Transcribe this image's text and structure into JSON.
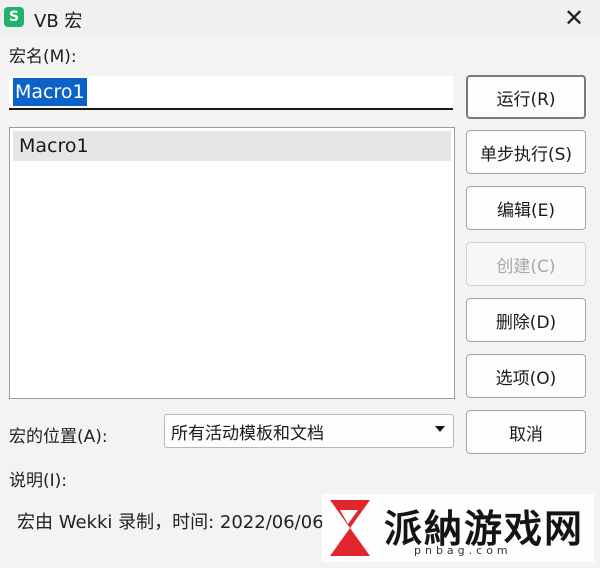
{
  "window": {
    "app_icon_letter": "S",
    "title": "VB 宏",
    "close_symbol": "✕"
  },
  "macro_name": {
    "label": "宏名(M):",
    "value": "Macro1"
  },
  "macro_list": {
    "items": [
      "Macro1"
    ]
  },
  "buttons": {
    "run": "运行(R)",
    "step": "单步执行(S)",
    "edit": "编辑(E)",
    "create": "创建(C)",
    "delete": "删除(D)",
    "options": "选项(O)",
    "cancel": "取消"
  },
  "location": {
    "label": "宏的位置(A):",
    "selected": "所有活动模板和文档"
  },
  "description": {
    "label": "说明(I):",
    "text": "宏由 Wekki 录制，时间: 2022/06/06"
  },
  "watermark": {
    "text": "派納游戏网",
    "url": "pnbag.com",
    "color": "#e0262c"
  }
}
